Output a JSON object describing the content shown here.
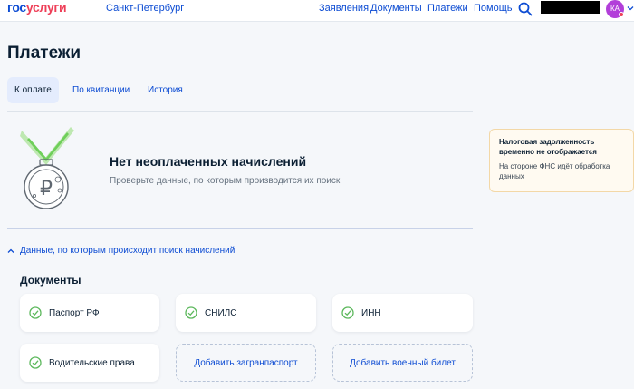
{
  "header": {
    "logo_part1": "гос",
    "logo_part2": "услуги",
    "city": "Санкт-Петербург",
    "nav": [
      "Заявления",
      "Документы",
      "Платежи",
      "Помощь"
    ],
    "avatar_initials": "КА"
  },
  "page": {
    "title": "Платежи",
    "tabs": [
      "К оплате",
      "По квитанции",
      "История"
    ],
    "active_tab": "К оплате"
  },
  "empty_state": {
    "title": "Нет неоплаченных начислений",
    "subtitle": "Проверьте данные, по которым производится их поиск"
  },
  "search_toggle": {
    "label": "Данные, по которым происходит поиск начислений"
  },
  "documents": {
    "title": "Документы",
    "items": [
      {
        "label": "Паспорт РФ",
        "status": "checked"
      },
      {
        "label": "СНИЛС",
        "status": "checked"
      },
      {
        "label": "ИНН",
        "status": "checked"
      },
      {
        "label": "Водительские права",
        "status": "checked"
      },
      {
        "label": "Добавить загранпаспорт",
        "status": "add"
      },
      {
        "label": "Добавить военный билет",
        "status": "add"
      }
    ]
  },
  "notice": {
    "title": "Налоговая задолженность временно не отображается",
    "text": "На стороне ФНС идёт обработка данных"
  },
  "colors": {
    "brand_blue": "#0d4cd3",
    "brand_red": "#ee3f58",
    "check_green": "#5cb85c",
    "avatar_purple": "#b23fd9",
    "background": "#f5f7fa"
  },
  "icons": {
    "search": "search-icon",
    "check": "check-circle-icon",
    "chevron": "chevron-down-icon",
    "medal": "ruble-medal-icon"
  }
}
